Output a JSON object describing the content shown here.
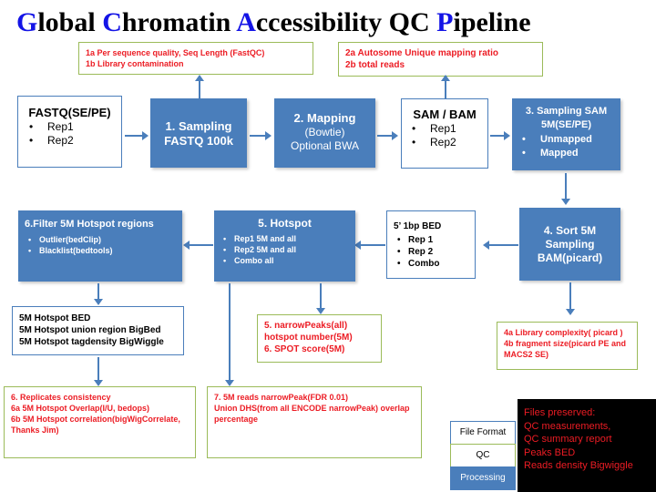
{
  "title": {
    "parts": [
      {
        "cap": "G",
        "rest": "lobal "
      },
      {
        "cap": "C",
        "rest": "hromatin "
      },
      {
        "cap": "A",
        "rest": "ccessibility "
      },
      {
        "cap": "",
        "rest": "QC "
      },
      {
        "cap": "P",
        "rest": "ipeline"
      }
    ],
    "plain": "Global Chromatin Accessibility QC Pipeline"
  },
  "qc_notes": {
    "note1": {
      "line1": "1a Per sequence quality, Seq Length (FastQC)",
      "line2": "1b Library contamination"
    },
    "note2": {
      "line1": "2a Autosome Unique mapping ratio",
      "line2": "2b total reads"
    },
    "note4": {
      "line1": "4a Library complexity( picard )",
      "line2": "4b fragment size(picard PE and",
      "line3": "MACS2 SE)"
    },
    "note56": {
      "line1": "5. narrowPeaks(all)",
      "line2": "hotspot number(5M)",
      "line3": "6. SPOT score(5M)"
    },
    "note6": {
      "line1": "6. Replicates consistency",
      "line2": "6a 5M Hotspot Overlap(I/U, bedops)",
      "line3": "6b 5M Hotspot correlation(bigWigCorrelate,",
      "line4": "Thanks Jim)"
    },
    "note7": {
      "line1": "7. 5M reads narrowPeak(FDR 0.01)",
      "line2": "Union DHS(from all ENCODE narrowPeak) overlap",
      "line3": "percentage"
    }
  },
  "flow": {
    "fastq": {
      "title": "FASTQ(SE/PE)",
      "items": [
        "Rep1",
        "Rep2"
      ]
    },
    "step1": {
      "line1": "1. Sampling",
      "line2": "FASTQ 100k"
    },
    "step2": {
      "line1": "2. Mapping",
      "line2": "(Bowtie)",
      "line3": "Optional BWA"
    },
    "sambam": {
      "title": "SAM / BAM",
      "items": [
        "Rep1",
        "Rep2"
      ]
    },
    "step3": {
      "line1": "3. Sampling SAM",
      "line2": "5M(SE/PE)",
      "items": [
        "Unmapped",
        "Mapped"
      ]
    },
    "step4": {
      "line1": "4. Sort 5M",
      "line2": "Sampling",
      "line3": "BAM(picard)"
    },
    "bed": {
      "title": "5’ 1bp BED",
      "items": [
        "Rep 1",
        "Rep 2",
        "Combo"
      ]
    },
    "step5": {
      "title": "5. Hotspot",
      "items": [
        "Rep1 5M and all",
        "Rep2 5M  and all",
        "Combo all"
      ]
    },
    "step6": {
      "title": "6.Filter 5M Hotspot regions",
      "items": [
        "Outlier(bedClip)",
        "Blacklist(bedtools)"
      ]
    },
    "hotspot_out": {
      "line1": "5M Hotspot BED",
      "line2": "5M Hotspot union region BigBed",
      "line3": "5M Hotspot tagdensity BigWiggle"
    }
  },
  "legend": {
    "file_format": "File Format",
    "qc": "QC",
    "processing": "Processing"
  },
  "preserved": {
    "lines": [
      "Files preserved:",
      "QC measurements,",
      "QC summary report",
      "Peaks BED",
      "Reads density Bigwiggle"
    ]
  },
  "colors": {
    "blue": "#4a7ebb",
    "green": "#9bbb59",
    "red": "#ec1c24",
    "title_blue": "#1414e6",
    "black": "#000000"
  }
}
